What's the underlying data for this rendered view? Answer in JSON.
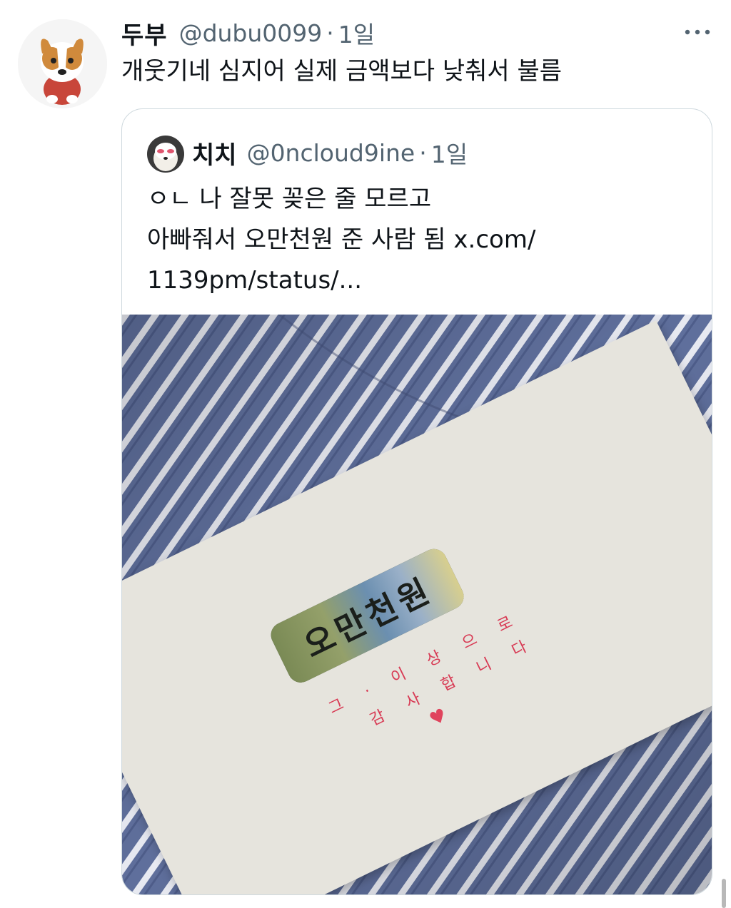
{
  "tweet": {
    "display_name": "두부",
    "handle": "@dubu0099",
    "separator": "·",
    "time": "1일",
    "text": "개웃기네 심지어 실제 금액보다 낮춰서 불름"
  },
  "quoted_tweet": {
    "display_name": "치치",
    "handle": "@0ncloud9ine",
    "separator": "·",
    "time": "1일",
    "text_lines": [
      "ㅇㄴ 나 잘못 꽂은 줄 모르고",
      "아빠줘서 오만천원 준 사람 됨 x.com/",
      "1139pm/status/..."
    ],
    "image": {
      "window_label": "오만천원",
      "stamp_line_1": "그 · 이 상 으 로",
      "stamp_line_2": "감 사 합 니 다",
      "stamp_heart": "♥"
    }
  },
  "icons": {
    "more": "more-horizontal-icon"
  },
  "colors": {
    "text_primary": "#0f1419",
    "text_secondary": "#536471",
    "card_border": "#cfd9de",
    "stripe_blue": "#5f6f9c",
    "envelope": "#e6e4dd",
    "stamp_red": "#d83a54"
  }
}
